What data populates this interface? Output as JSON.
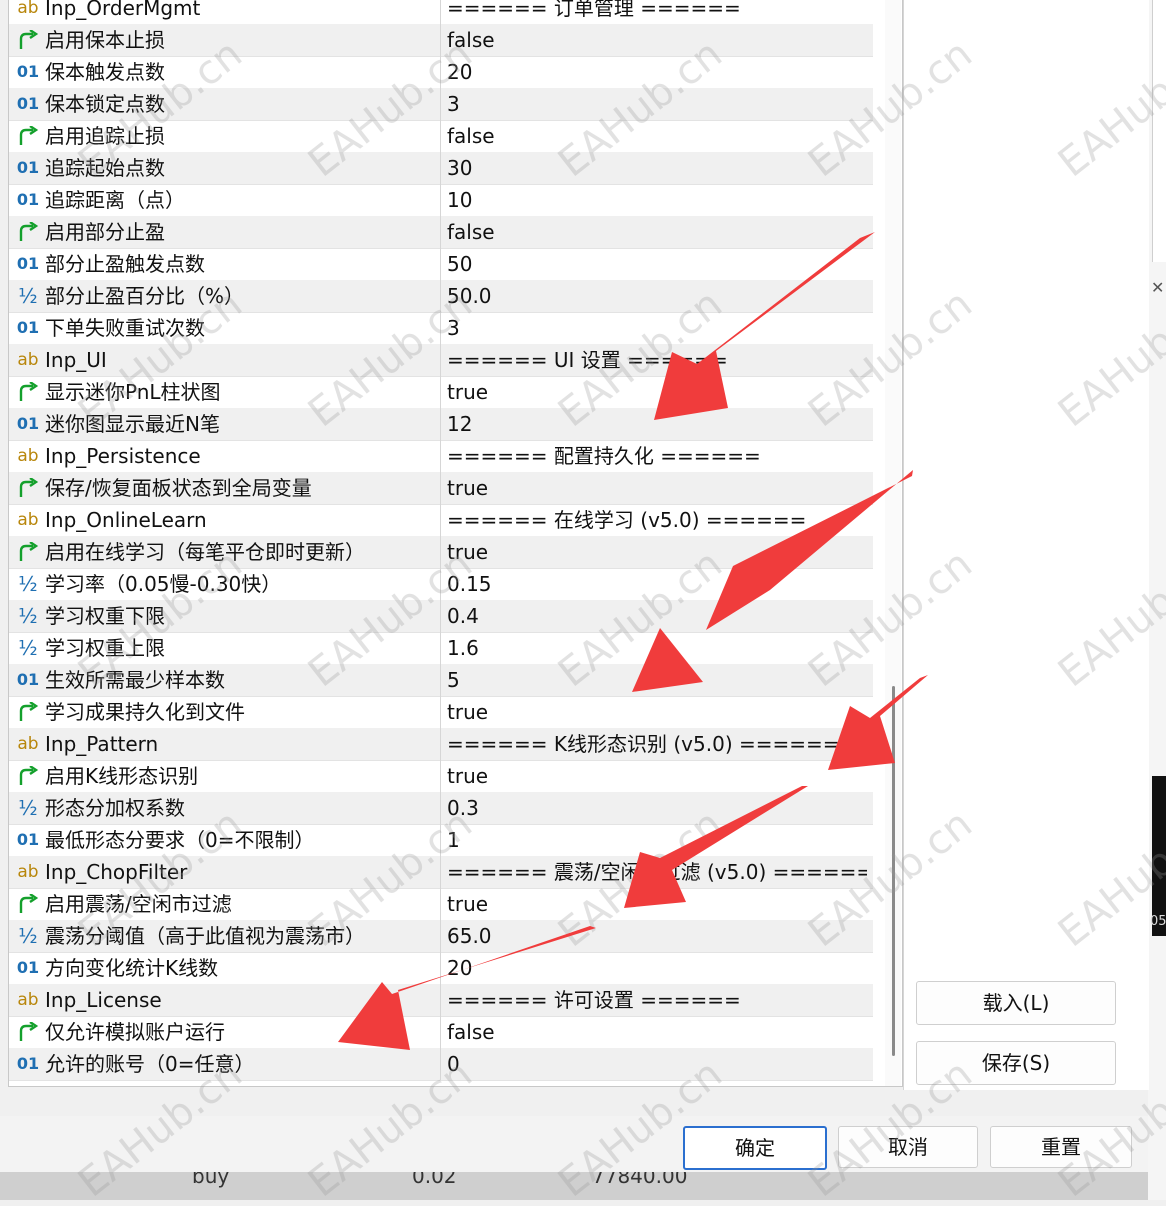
{
  "rows": [
    {
      "type": "ab",
      "name": "Inp_OrderMgmt",
      "value": "====== 订单管理 ======"
    },
    {
      "type": "bool",
      "name": "启用保本止损",
      "value": "false"
    },
    {
      "type": "int",
      "name": "保本触发点数",
      "value": "20"
    },
    {
      "type": "int",
      "name": "保本锁定点数",
      "value": "3"
    },
    {
      "type": "bool",
      "name": "启用追踪止损",
      "value": "false"
    },
    {
      "type": "int",
      "name": "追踪起始点数",
      "value": "30"
    },
    {
      "type": "int",
      "name": "追踪距离（点）",
      "value": "10"
    },
    {
      "type": "bool",
      "name": "启用部分止盈",
      "value": "false"
    },
    {
      "type": "int",
      "name": "部分止盈触发点数",
      "value": "50"
    },
    {
      "type": "double",
      "name": "部分止盈百分比（%）",
      "value": "50.0"
    },
    {
      "type": "int",
      "name": "下单失败重试次数",
      "value": "3"
    },
    {
      "type": "ab",
      "name": "Inp_UI",
      "value": "====== UI 设置 ======"
    },
    {
      "type": "bool",
      "name": "显示迷你PnL柱状图",
      "value": "true"
    },
    {
      "type": "int",
      "name": "迷你图显示最近N笔",
      "value": "12"
    },
    {
      "type": "ab",
      "name": "Inp_Persistence",
      "value": "====== 配置持久化 ======"
    },
    {
      "type": "bool",
      "name": "保存/恢复面板状态到全局变量",
      "value": "true"
    },
    {
      "type": "ab",
      "name": "Inp_OnlineLearn",
      "value": "====== 在线学习 (v5.0) ======"
    },
    {
      "type": "bool",
      "name": "启用在线学习（每笔平仓即时更新）",
      "value": "true"
    },
    {
      "type": "double",
      "name": "学习率（0.05慢-0.30快）",
      "value": "0.15"
    },
    {
      "type": "double",
      "name": "学习权重下限",
      "value": "0.4"
    },
    {
      "type": "double",
      "name": "学习权重上限",
      "value": "1.6"
    },
    {
      "type": "int",
      "name": "生效所需最少样本数",
      "value": "5"
    },
    {
      "type": "bool",
      "name": "学习成果持久化到文件",
      "value": "true"
    },
    {
      "type": "ab",
      "name": "Inp_Pattern",
      "value": "====== K线形态识别 (v5.0) ======"
    },
    {
      "type": "bool",
      "name": "启用K线形态识别",
      "value": "true"
    },
    {
      "type": "double",
      "name": "形态分加权系数",
      "value": "0.3"
    },
    {
      "type": "int",
      "name": "最低形态分要求（0=不限制）",
      "value": "1"
    },
    {
      "type": "ab",
      "name": "Inp_ChopFilter",
      "value": "====== 震荡/空闲市过滤 (v5.0) ======"
    },
    {
      "type": "bool",
      "name": "启用震荡/空闲市过滤",
      "value": "true"
    },
    {
      "type": "double",
      "name": "震荡分阈值（高于此值视为震荡市）",
      "value": "65.0"
    },
    {
      "type": "int",
      "name": "方向变化统计K线数",
      "value": "20"
    },
    {
      "type": "ab",
      "name": "Inp_License",
      "value": "====== 许可设置 ======"
    },
    {
      "type": "bool",
      "name": "仅允许模拟账户运行",
      "value": "false"
    },
    {
      "type": "int",
      "name": "允许的账号（0=任意）",
      "value": "0"
    }
  ],
  "icons": {
    "ab": "ab",
    "int": "01",
    "double": "½",
    "bool": "bool-arrow-icon"
  },
  "buttons": {
    "load": "载入(L)",
    "save": "保存(S)",
    "ok": "确定",
    "cancel": "取消",
    "reset": "重置"
  },
  "bottom_strip": {
    "side": "buy",
    "volume": "0.02",
    "price": "77840.00"
  },
  "edge_label": "05",
  "watermark": "EAHub.cn",
  "colors": {
    "arrow": "#f03c3c",
    "accent": "#2b6fcf",
    "bool_icon": "#14a02c"
  }
}
